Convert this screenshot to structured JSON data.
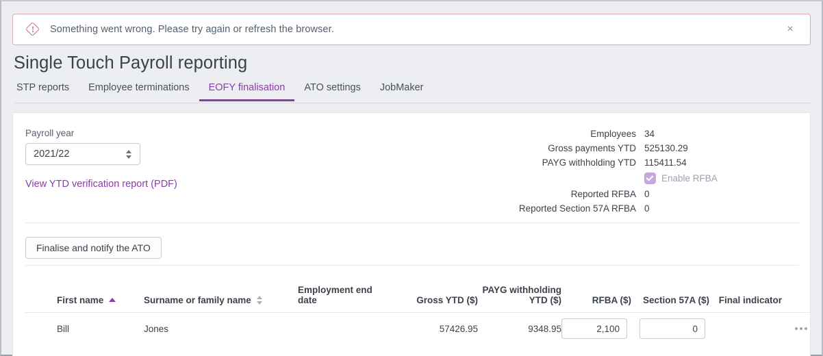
{
  "alert": {
    "icon": "error-diamond-icon",
    "message": "Something went wrong. Please try again or refresh the browser.",
    "close_label": "×"
  },
  "page": {
    "title": "Single Touch Payroll reporting"
  },
  "tabs": [
    {
      "label": "STP reports",
      "active": false
    },
    {
      "label": "Employee terminations",
      "active": false
    },
    {
      "label": "EOFY finalisation",
      "active": true
    },
    {
      "label": "ATO settings",
      "active": false
    },
    {
      "label": "JobMaker",
      "active": false
    }
  ],
  "filters": {
    "payroll_year_label": "Payroll year",
    "payroll_year_value": "2021/22",
    "pdf_link": "View YTD verification report (PDF)"
  },
  "summary": {
    "employees_label": "Employees",
    "employees_value": "34",
    "gross_label": "Gross payments YTD",
    "gross_value": "525130.29",
    "payg_label": "PAYG withholding YTD",
    "payg_value": "115411.54",
    "enable_rfba_label": "Enable RFBA",
    "enable_rfba_checked": true,
    "enable_rfba_disabled": true,
    "reported_rfba_label": "Reported RFBA",
    "reported_rfba_value": "0",
    "reported_s57a_label": "Reported Section 57A RFBA",
    "reported_s57a_value": "0"
  },
  "actions": {
    "finalise_label": "Finalise and notify the ATO"
  },
  "table": {
    "columns": {
      "first_name": "First name",
      "surname": "Surname or family name",
      "employment_end_date": "Employment end date",
      "gross_ytd": "Gross YTD ($)",
      "payg_withholding_ytd": "PAYG withholding YTD ($)",
      "rfba": "RFBA ($)",
      "section_57a": "Section 57A ($)",
      "final_indicator": "Final indicator"
    },
    "header_checkbox_state": "indeterminate",
    "sort": {
      "first_name": "ascending",
      "surname": "none"
    },
    "rows": [
      {
        "selected": true,
        "first_name": "Bill",
        "surname": "Jones",
        "employment_end_date": "",
        "gross_ytd": "57426.95",
        "payg_withholding_ytd": "9348.95",
        "rfba": "2,100",
        "section_57a": "0",
        "final_indicator": "",
        "menu": "more-options"
      }
    ]
  },
  "colors": {
    "accent": "#8a3caa",
    "alert_border": "#dba7bb",
    "alert_icon": "#d2688e",
    "page_bg": "#eceef1",
    "card_bg": "#ffffff",
    "text": "#3b424b"
  }
}
